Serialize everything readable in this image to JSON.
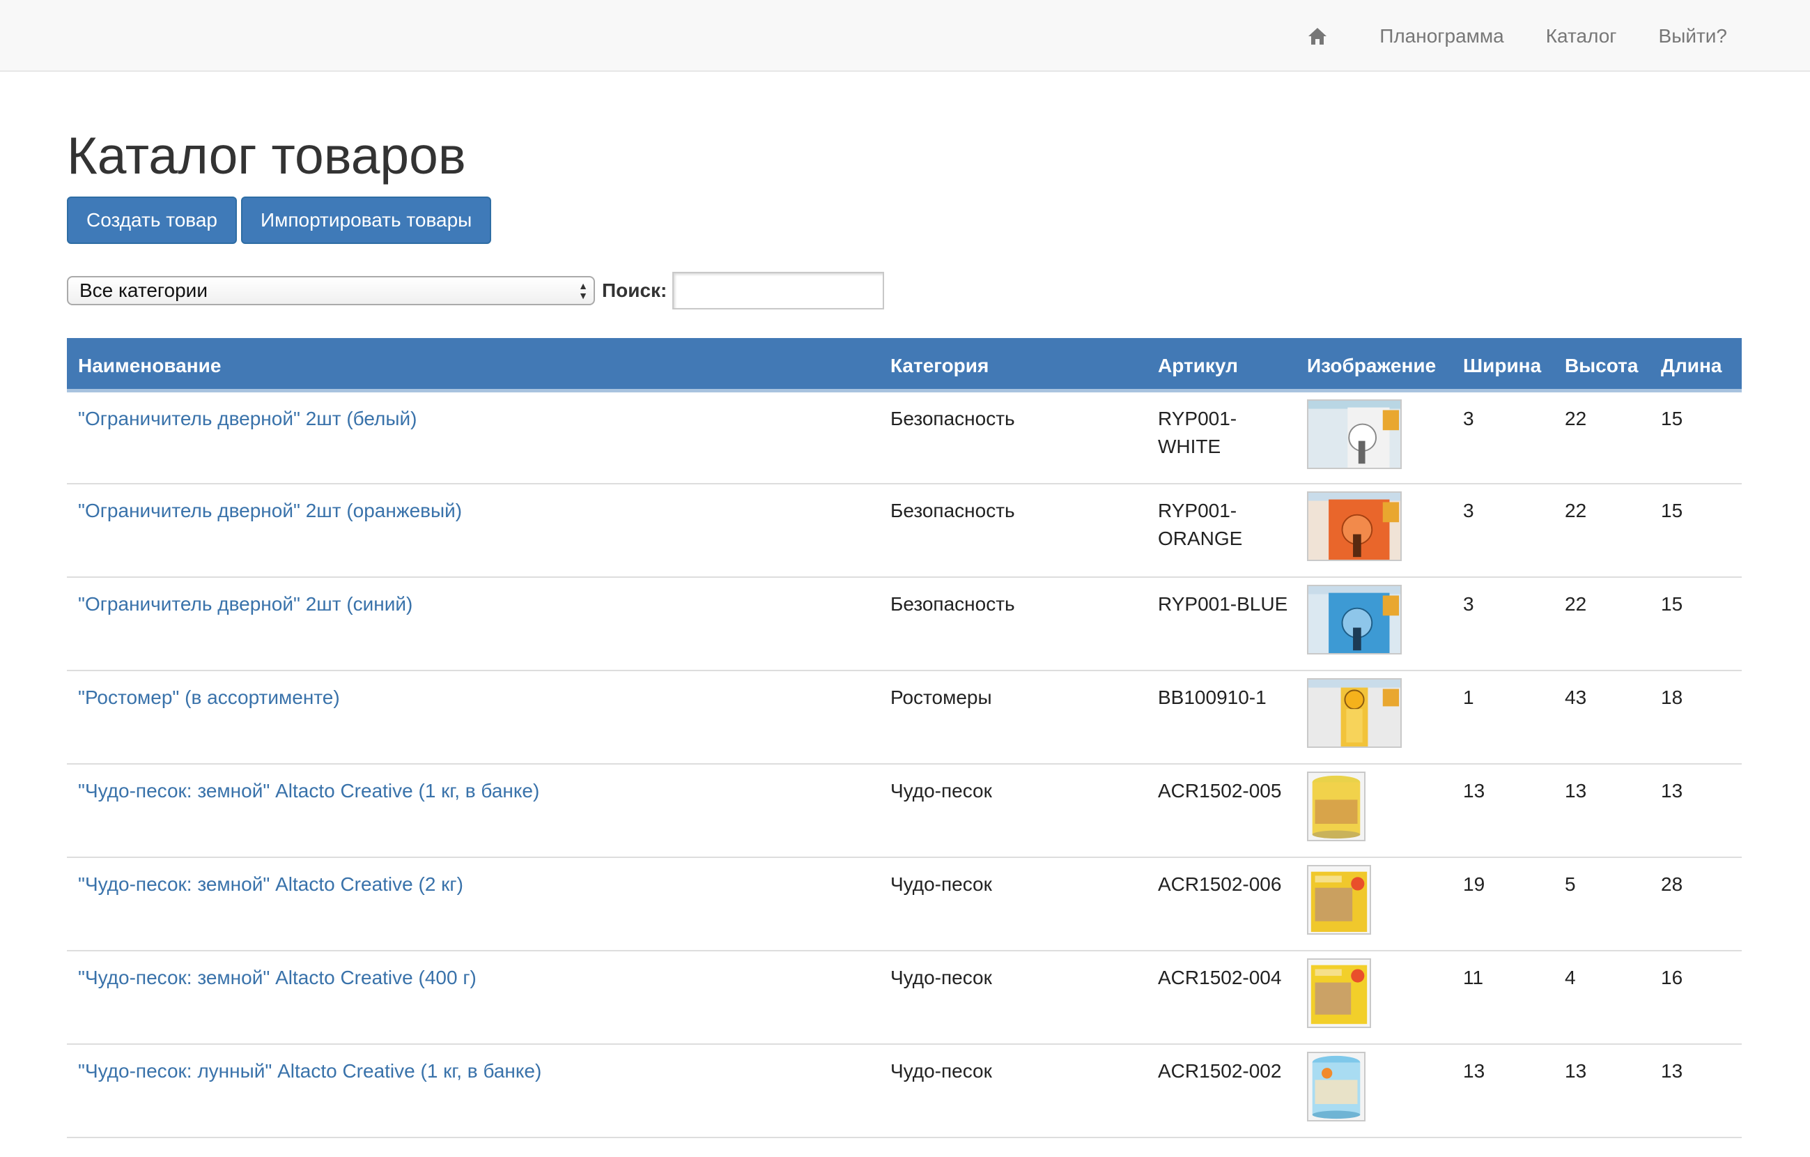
{
  "nav": {
    "home_icon": "home-icon",
    "links": [
      "Планограмма",
      "Каталог",
      "Выйти?"
    ]
  },
  "page": {
    "title": "Каталог товаров"
  },
  "actions": {
    "create_label": "Создать товар",
    "import_label": "Импортировать товары"
  },
  "filter": {
    "category_selected": "Все категории",
    "search_label": "Поиск:",
    "search_value": ""
  },
  "table": {
    "headers": [
      "Наименование",
      "Категория",
      "Артикул",
      "Изображение",
      "Ширина",
      "Высота",
      "Длина"
    ],
    "rows": [
      {
        "name": "\"Ограничитель дверной\" 2шт (белый)",
        "category": "Безопасность",
        "sku": "RYP001-WHITE",
        "image": "door-stopper-white",
        "width": "3",
        "height": "22",
        "length": "15"
      },
      {
        "name": "\"Ограничитель дверной\" 2шт (оранжевый)",
        "category": "Безопасность",
        "sku": "RYP001-ORANGE",
        "image": "door-stopper-orange",
        "width": "3",
        "height": "22",
        "length": "15"
      },
      {
        "name": "\"Ограничитель дверной\" 2шт (синий)",
        "category": "Безопасность",
        "sku": "RYP001-BLUE",
        "image": "door-stopper-blue",
        "width": "3",
        "height": "22",
        "length": "15"
      },
      {
        "name": "\"Ростомер\" (в ассортименте)",
        "category": "Ростомеры",
        "sku": "BB100910-1",
        "image": "height-chart",
        "width": "1",
        "height": "43",
        "length": "18"
      },
      {
        "name": "\"Чудо-песок: земной\" Altacto Creative (1 кг, в банке)",
        "category": "Чудо-песок",
        "sku": "ACR1502-005",
        "image": "sand-jar-yellow",
        "width": "13",
        "height": "13",
        "length": "13"
      },
      {
        "name": "\"Чудо-песок: земной\" Altacto Creative (2 кг)",
        "category": "Чудо-песок",
        "sku": "ACR1502-006",
        "image": "sand-box-2kg",
        "width": "19",
        "height": "5",
        "length": "28"
      },
      {
        "name": "\"Чудо-песок: земной\" Altacto Creative (400 г)",
        "category": "Чудо-песок",
        "sku": "ACR1502-004",
        "image": "sand-box-400g",
        "width": "11",
        "height": "4",
        "length": "16"
      },
      {
        "name": "\"Чудо-песок: лунный\" Altacto Creative (1 кг, в банке)",
        "category": "Чудо-песок",
        "sku": "ACR1502-002",
        "image": "sand-jar-blue",
        "width": "13",
        "height": "13",
        "length": "13"
      }
    ]
  },
  "colors": {
    "header_bg": "#4279b5",
    "button_bg": "#3f7ab8",
    "link": "#3972aa"
  }
}
